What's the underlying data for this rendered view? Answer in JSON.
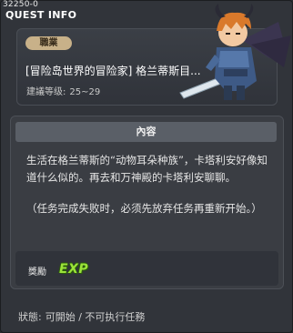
{
  "window": {
    "quest_id": "32250-0",
    "title": "QUEST INFO"
  },
  "quest": {
    "job_badge": "職業",
    "title": "[冒险岛世界的冒险家] 格兰蒂斯目...",
    "recommend_label": "建議等级:",
    "recommend_value": "25~29"
  },
  "content": {
    "header": "內容",
    "description": "生活在格兰蒂斯的“动物耳朵种族”，卡塔利安好像知道什么似的。再去和万神殿的卡塔利安聊聊。",
    "note": "（任务完成失败时，必须先放弃任务再重新开始。）",
    "reward_label": "獎勵",
    "reward_icon_text": "EXP"
  },
  "status": {
    "label": "狀態:",
    "value": "可開始 / 不可执行任務"
  },
  "colors": {
    "background": "#31343a",
    "badge": "#c8b189",
    "header_bar": "#5a5f67",
    "exp_green": "#9be33a"
  },
  "icons": {
    "character": "dark-armored-warrior-sprite",
    "exp": "exp-reward-icon"
  }
}
